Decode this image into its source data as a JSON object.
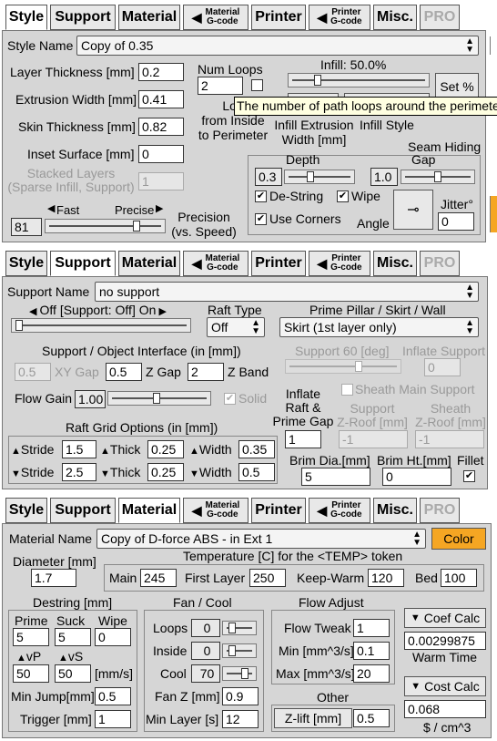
{
  "tabs": {
    "style": "Style",
    "support": "Support",
    "material": "Material",
    "material_gcode_1": "Material",
    "material_gcode_2": "G-code",
    "printer": "Printer",
    "printer_gcode_1": "Printer",
    "printer_gcode_2": "G-code",
    "misc": "Misc.",
    "pro": "PRO"
  },
  "style": {
    "name_label": "Style Name",
    "name_value": "Copy of 0.35",
    "layer_thickness_label": "Layer Thickness [mm]",
    "layer_thickness": "0.2",
    "extrusion_width_label": "Extrusion Width [mm]",
    "extrusion_width": "0.41",
    "skin_thickness_label": "Skin Thickness [mm]",
    "skin_thickness": "0.82",
    "inset_surface_label": "Inset  Surface [mm]",
    "inset_surface": "0",
    "stacked_layers_label_1": "Stacked Layers",
    "stacked_layers_label_2": "(Sparse Infill, Support)",
    "stacked_layers": "1",
    "num_loops_label": "Num Loops",
    "num_loops": "2",
    "loops_inside_1": "Loo",
    "loops_inside_2": "from Inside",
    "loops_inside_3": "to Perimeter",
    "infill_label": "Infill: 50.0%",
    "infill_extrusion_1": "Infill Extrusion",
    "infill_extrusion_2": "Width [mm]",
    "infill_style": "Infill Style",
    "set_percent": "Set %",
    "tooltip": "The number of path loops around the perimeter",
    "fast": "Fast",
    "precise": "Precise",
    "speed_value": "81",
    "precision_1": "Precision",
    "precision_2": "(vs. Speed)",
    "seam_hiding": "Seam Hiding",
    "depth": "Depth",
    "gap": "Gap",
    "depth_value": "0.3",
    "gap_value": "1.0",
    "de_string": "De-String",
    "wipe": "Wipe",
    "use_corners": "Use Corners",
    "angle": "Angle",
    "jitter": "Jitter°",
    "jitter_value": "0"
  },
  "support": {
    "name_label": "Support Name",
    "name_value": "no support",
    "off_on": "Off [Support: Off] On",
    "raft_type_label": "Raft Type",
    "raft_type": "Off",
    "prime_label": "Prime Pillar / Skirt /  Wall",
    "prime_value": "Skirt (1st layer only)",
    "interface_label": "Support / Object Interface (in [mm])",
    "xy_gap": "0.5",
    "xy_gap_label": "XY Gap",
    "z_gap": "0.5",
    "z_gap_label": "Z Gap",
    "z_band": "2",
    "z_band_label": "Z Band",
    "flow_gain_label": "Flow Gain",
    "flow_gain": "1.00",
    "solid": "Solid",
    "support_angle": "Support 60 [deg]",
    "inflate_support": "Inflate Support",
    "inflate_support_value": "0",
    "sheath_main": "Sheath Main Support",
    "inflate_raft_1": "Inflate",
    "inflate_raft_2": "Raft &",
    "inflate_raft_3": "Prime Gap",
    "inflate_raft_value": "1",
    "support_zroof_1": "Support",
    "support_zroof_2": "Z-Roof [mm]",
    "support_zroof_value": "-1",
    "sheath_zroof_1": "Sheath",
    "sheath_zroof_2": "Z-Roof [mm]",
    "sheath_zroof_value": "-1",
    "raft_grid": "Raft Grid Options (in [mm])",
    "stride": "Stride",
    "thick": "Thick",
    "width": "Width",
    "stride_up": "1.5",
    "thick_up": "0.25",
    "width_up": "0.35",
    "stride_down": "2.5",
    "thick_down": "0.25",
    "width_down": "0.5",
    "brim_dia_label": "Brim Dia.[mm]",
    "brim_dia": "5",
    "brim_ht_label": "Brim Ht.[mm]",
    "brim_ht": "0",
    "fillet": "Fillet"
  },
  "material": {
    "name_label": "Material Name",
    "name_value": "Copy of D-force ABS - in Ext 1",
    "color_btn": "Color",
    "diameter_label": "Diameter [mm]",
    "diameter": "1.7",
    "temp_label": "Temperature [C] for the <TEMP> token",
    "main_label": "Main",
    "main": "245",
    "first_layer_label": "First Layer",
    "first_layer": "250",
    "keep_warm_label": "Keep-Warm",
    "keep_warm": "120",
    "bed_label": "Bed",
    "bed": "100",
    "destring_label": "Destring [mm]",
    "prime_label": "Prime",
    "prime": "5",
    "suck_label": "Suck",
    "suck": "5",
    "wipe_label": "Wipe",
    "wipe": "0",
    "vp_label": "vP",
    "vp": "50",
    "vs_label": "vS",
    "vs": "50",
    "mms": "[mm/s]",
    "min_jump_label": "Min Jump[mm]",
    "min_jump": "0.5",
    "trigger_label": "Trigger [mm]",
    "trigger": "1",
    "fan_label": "Fan / Cool",
    "loops_label": "Loops",
    "loops": "0",
    "inside_label": "Inside",
    "inside": "0",
    "cool_label": "Cool",
    "cool": "70",
    "fan_z_label": "Fan Z [mm]",
    "fan_z": "0.9",
    "min_layer_label": "Min Layer [s]",
    "min_layer": "12",
    "flow_adjust_label": "Flow Adjust",
    "flow_tweak_label": "Flow Tweak",
    "flow_tweak": "1",
    "min_flow_label": "Min [mm^3/s]",
    "min_flow": "0.1",
    "max_flow_label": "Max [mm^3/s]",
    "max_flow": "20",
    "other_label": "Other",
    "zlift_btn": "Z-lift [mm]",
    "zlift": "0.5",
    "coef_calc": "Coef Calc",
    "coef": "0.00299875",
    "warm_time": "Warm Time",
    "cost_calc": "Cost Calc",
    "cost": "0.068",
    "cost_unit": "$ / cm^3"
  },
  "colors": {
    "panel": "#d6d6d6",
    "color_button": "#f5a623",
    "tooltip": "#ffffe1"
  }
}
